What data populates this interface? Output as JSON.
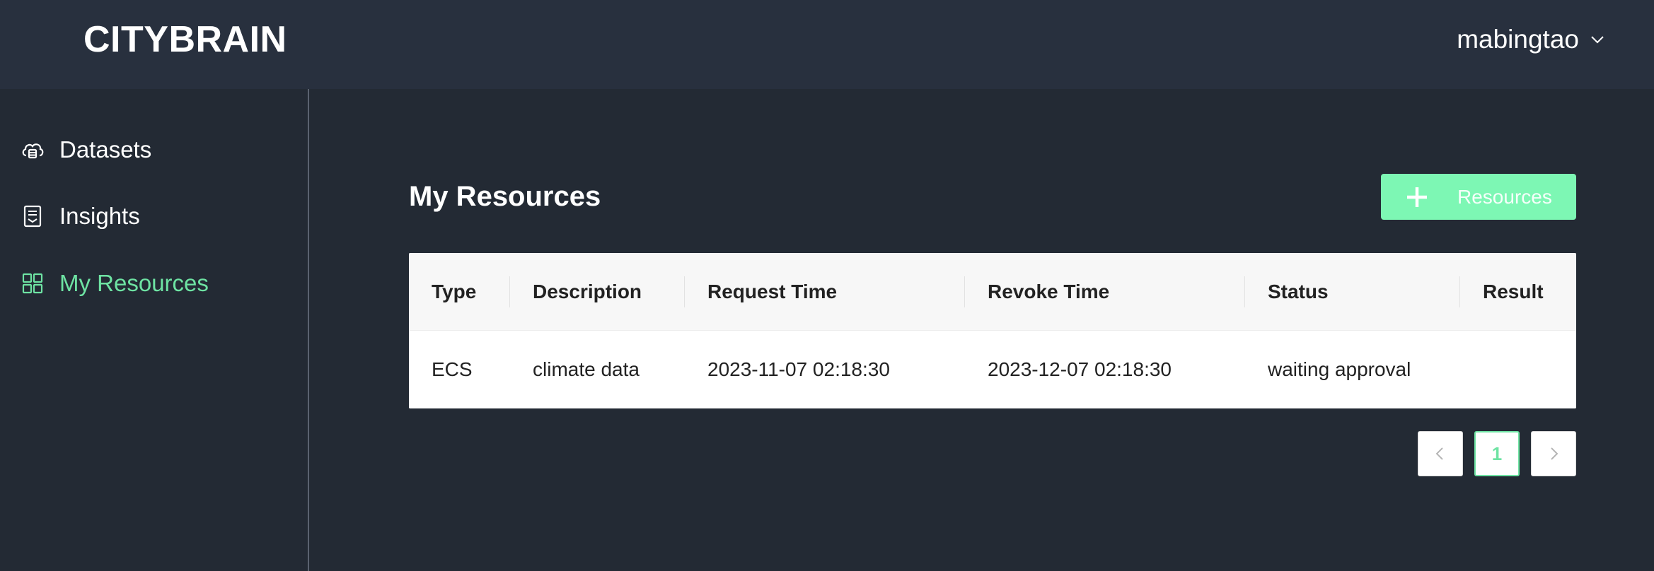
{
  "app": {
    "logo": "CITYBRAIN",
    "user": {
      "name": "mabingtao",
      "menu_icon": "chevron-down-icon"
    }
  },
  "sidebar": {
    "items": [
      {
        "label": "Datasets",
        "icon": "cloud-database-icon",
        "active": false
      },
      {
        "label": "Insights",
        "icon": "document-icon",
        "active": false
      },
      {
        "label": "My Resources",
        "icon": "grid-icon",
        "active": true
      }
    ]
  },
  "main": {
    "title": "My Resources",
    "add_button": {
      "label": "Resources",
      "icon": "plus-icon"
    },
    "table": {
      "columns": [
        "Type",
        "Description",
        "Request Time",
        "Revoke Time",
        "Status",
        "Result"
      ],
      "rows": [
        [
          "ECS",
          "climate data",
          "2023-11-07 02:18:30",
          "2023-12-07 02:18:30",
          "waiting approval",
          ""
        ]
      ]
    },
    "pagination": {
      "current_page": "1",
      "prev_icon": "chevron-left-icon",
      "next_icon": "chevron-right-icon"
    }
  },
  "colors": {
    "header_bg": "#28303e",
    "page_bg": "#232a34",
    "accent": "#6ee3a3",
    "button_bg": "#7df7b4"
  }
}
